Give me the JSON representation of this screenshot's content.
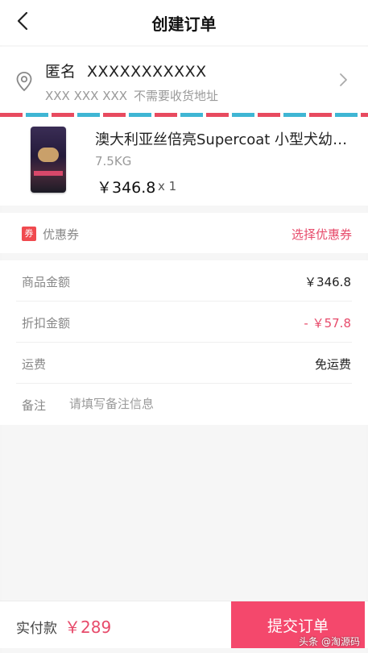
{
  "header": {
    "title": "创建订单",
    "back_icon": "chevron-left-icon"
  },
  "address": {
    "name": "匿名",
    "name_masked": "XXXXXXXXXXX",
    "phone_masked": "XXX XXX XXX",
    "note": "不需要收货地址",
    "location_icon": "location-pin-icon",
    "chevron_icon": "chevron-right-icon",
    "stripe_colors": [
      "#e84a5f",
      "#3fb6d4"
    ]
  },
  "product": {
    "title": "澳大利亚丝倍亮Supercoat 小型犬幼年犬粮",
    "spec": "7.5KG",
    "price": "￥346.8",
    "quantity": "x 1"
  },
  "coupon": {
    "badge": "券",
    "label": "优惠券",
    "action": "选择优惠券"
  },
  "summary": {
    "goods_label": "商品金额",
    "goods_value": "￥346.8",
    "discount_label": "折扣金额",
    "discount_value": "- ￥57.8",
    "shipping_label": "运费",
    "shipping_value": "免运费",
    "remark_label": "备注",
    "remark_placeholder": "请填写备注信息"
  },
  "footer": {
    "pay_label": "实付款",
    "pay_amount": "￥289",
    "submit_label": "提交订单"
  },
  "watermark": "头条 @淘源码",
  "colors": {
    "accent": "#f4486c",
    "price_red": "#e74b6b",
    "coupon_red": "#f04a4f"
  }
}
